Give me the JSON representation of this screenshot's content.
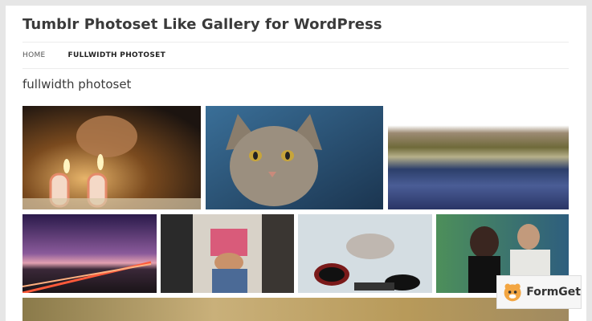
{
  "site": {
    "title": "Tumblr Photoset Like Gallery for WordPress"
  },
  "nav": {
    "items": [
      {
        "label": "HOME"
      },
      {
        "label": "FULLWIDTH PHOTOSET"
      }
    ]
  },
  "page": {
    "title": "fullwidth photoset"
  },
  "badge": {
    "text": "FormGet"
  }
}
